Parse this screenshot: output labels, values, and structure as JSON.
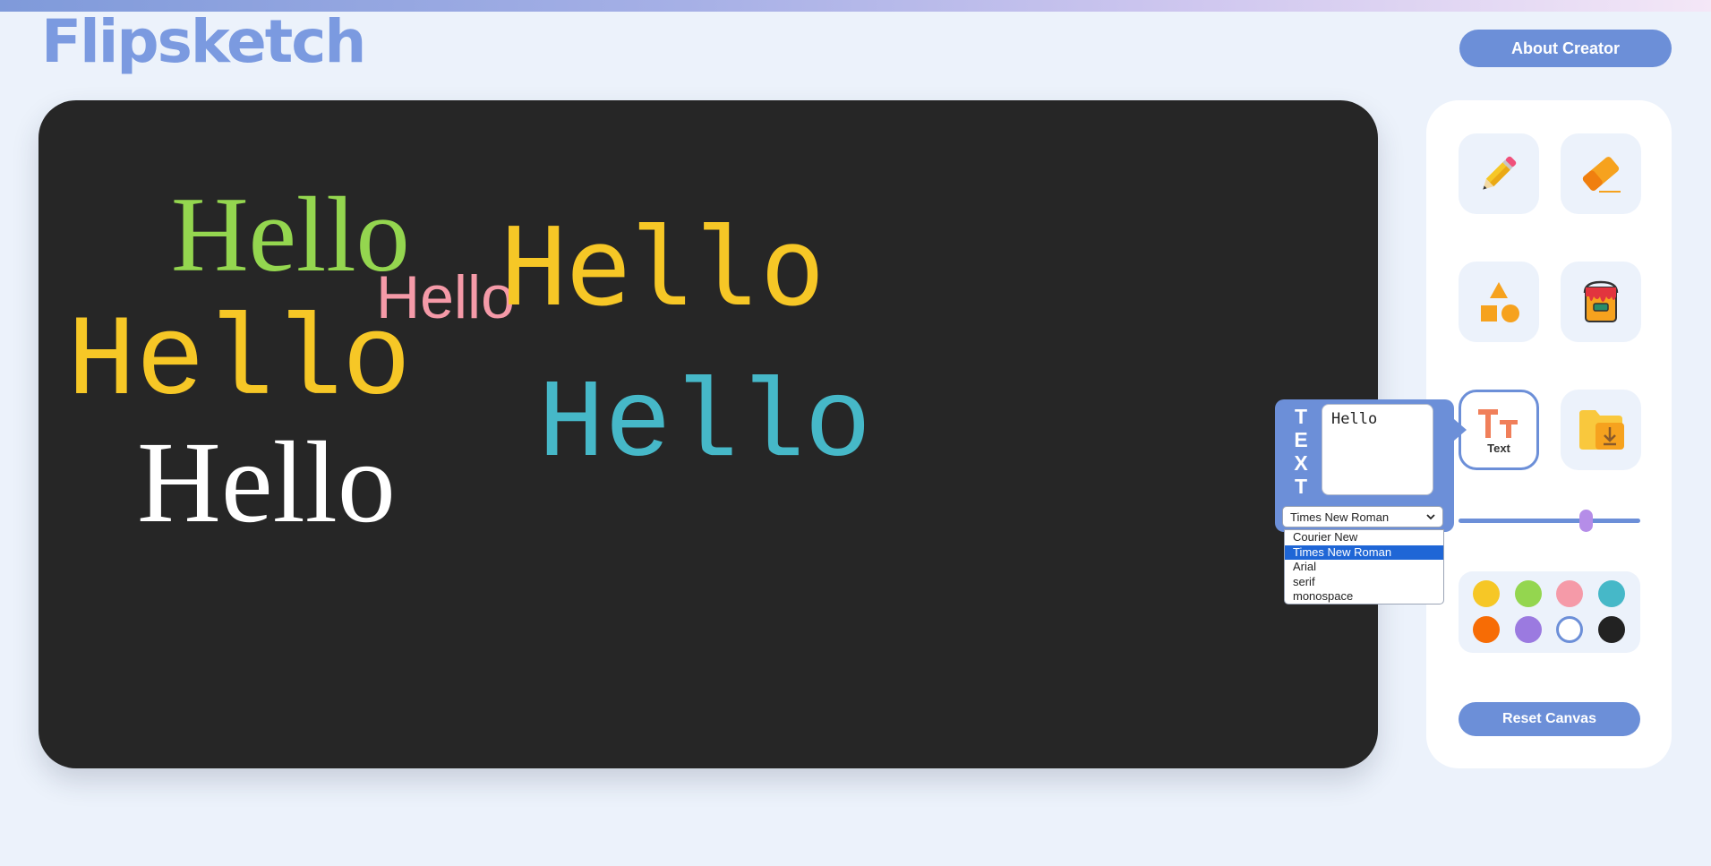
{
  "header": {
    "logo": "Flipsketch",
    "about_label": "About Creator"
  },
  "canvas": {
    "words": [
      {
        "text": "Hello",
        "color": "#94d64f",
        "font": "serif"
      },
      {
        "text": "Hello",
        "color": "#f59aa8",
        "font": "sans-serif"
      },
      {
        "text": "Hello",
        "color": "#f6c726",
        "font": "monospace"
      },
      {
        "text": "Hello",
        "color": "#f6c726",
        "font": "Courier New"
      },
      {
        "text": "Hello",
        "color": "#46b8c8",
        "font": "Courier New"
      },
      {
        "text": "Hello",
        "color": "#ffffff",
        "font": "Times New Roman"
      }
    ]
  },
  "tools": {
    "pencil": "pencil-icon",
    "eraser": "eraser-icon",
    "shapes": "shapes-icon",
    "fill": "paint-bucket-icon",
    "text": {
      "icon": "text-size-icon",
      "label": "Text"
    },
    "save": "folder-download-icon"
  },
  "brush_size": {
    "value_fraction": 0.7
  },
  "palette": {
    "colors": [
      "#f6c726",
      "#94d64f",
      "#f59aa8",
      "#46b8c8",
      "#f76c05",
      "#9b7ae0",
      "#ffffff",
      "#222222"
    ],
    "selected": "#ffffff"
  },
  "text_popup": {
    "vertical_label": "TEXT",
    "input_value": "Hello",
    "font_selected": "Times New Roman",
    "font_options": [
      "Courier New",
      "Times New Roman",
      "Arial",
      "serif",
      "monospace"
    ]
  },
  "reset_label": "Reset Canvas"
}
